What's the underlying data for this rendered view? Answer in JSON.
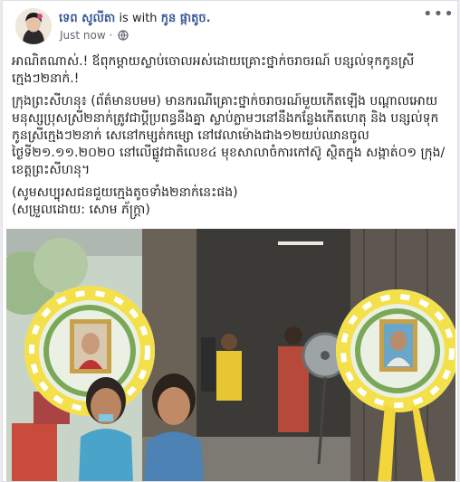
{
  "post": {
    "author": "ទេព សូលីតា",
    "with_text": "is with",
    "tagged": "កូន ផ្កាតូច.",
    "timestamp": "Just now",
    "dot": "·",
    "privacy_icon": "globe-icon",
    "more_icon": "more-horizontal-icon",
    "more_label": "•••",
    "paragraphs": [
      "អាណិតណាស់.! ឪពុកម្ដាយស្លាប់ចោលអស់ដោយគ្រោះថ្នាក់ចរាចរណ៍ បន្សល់ទុកកូនស្រីក្មេងៗ២នាក់.!",
      "ក្រុងព្រះសីហនុ៖ (ព័ត៌មានបមម) មានករណីគ្រោះថ្នាក់ចរាចរណ៍មួយកើតឡើង បណ្ដាលអោយមនុស្សប្រុសស្រី២នាក់ត្រូវជាប្ដីប្រពន្ធនឹងគ្នា ស្លាប់ភ្លាមៗនៅនឹងកន្លែងកើតហេតុ និង បន្សល់ទុកកូនស្រីក្មេងៗ២នាក់ សេនៅកម្សត់កម្សោ នៅវេលាម៉ោងជាង១២យប់ឈានចូលថ្ងៃទី២១.១១.២០២០ នៅលើផ្លូវជាតិលេខ៤ មុខសាលាចំការកៅស៊ូ ស្ថិតក្នុង សង្កាត់០១ ក្រុង/ខេត្តព្រះសីហនុ។",
      "(សូមសប្បុរសជនជួយក្មេងតូចទាំង២នាក់នេះផង)",
      "(សម្រួលដោយ: សោម ភ័ក្រ្តា)"
    ]
  }
}
